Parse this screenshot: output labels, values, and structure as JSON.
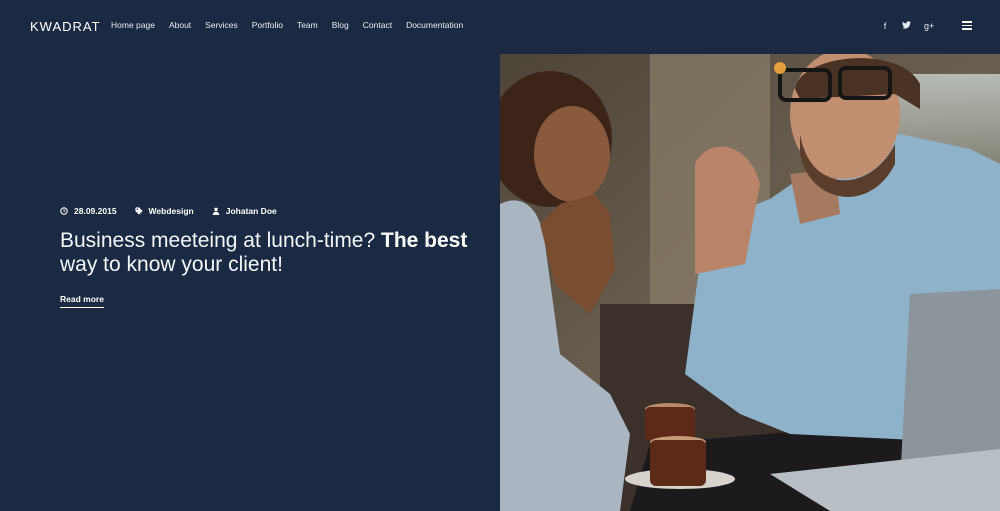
{
  "header": {
    "logo": "KWADRAT",
    "nav": [
      "Home page",
      "About",
      "Services",
      "Portfolio",
      "Team",
      "Blog",
      "Contact",
      "Documentation"
    ],
    "social": [
      "f",
      "t",
      "g+"
    ],
    "menu_icon": "hamburger-icon"
  },
  "post": {
    "date": "28.09.2015",
    "category": "Webdesign",
    "author": "Johatan Doe",
    "title_light_1": "Business meeteing at lunch-time? ",
    "title_bold": "The best",
    "title_light_2": "way to know your client!",
    "read_more": "Read more"
  },
  "colors": {
    "background": "#1b2a42",
    "text": "#ffffff"
  }
}
